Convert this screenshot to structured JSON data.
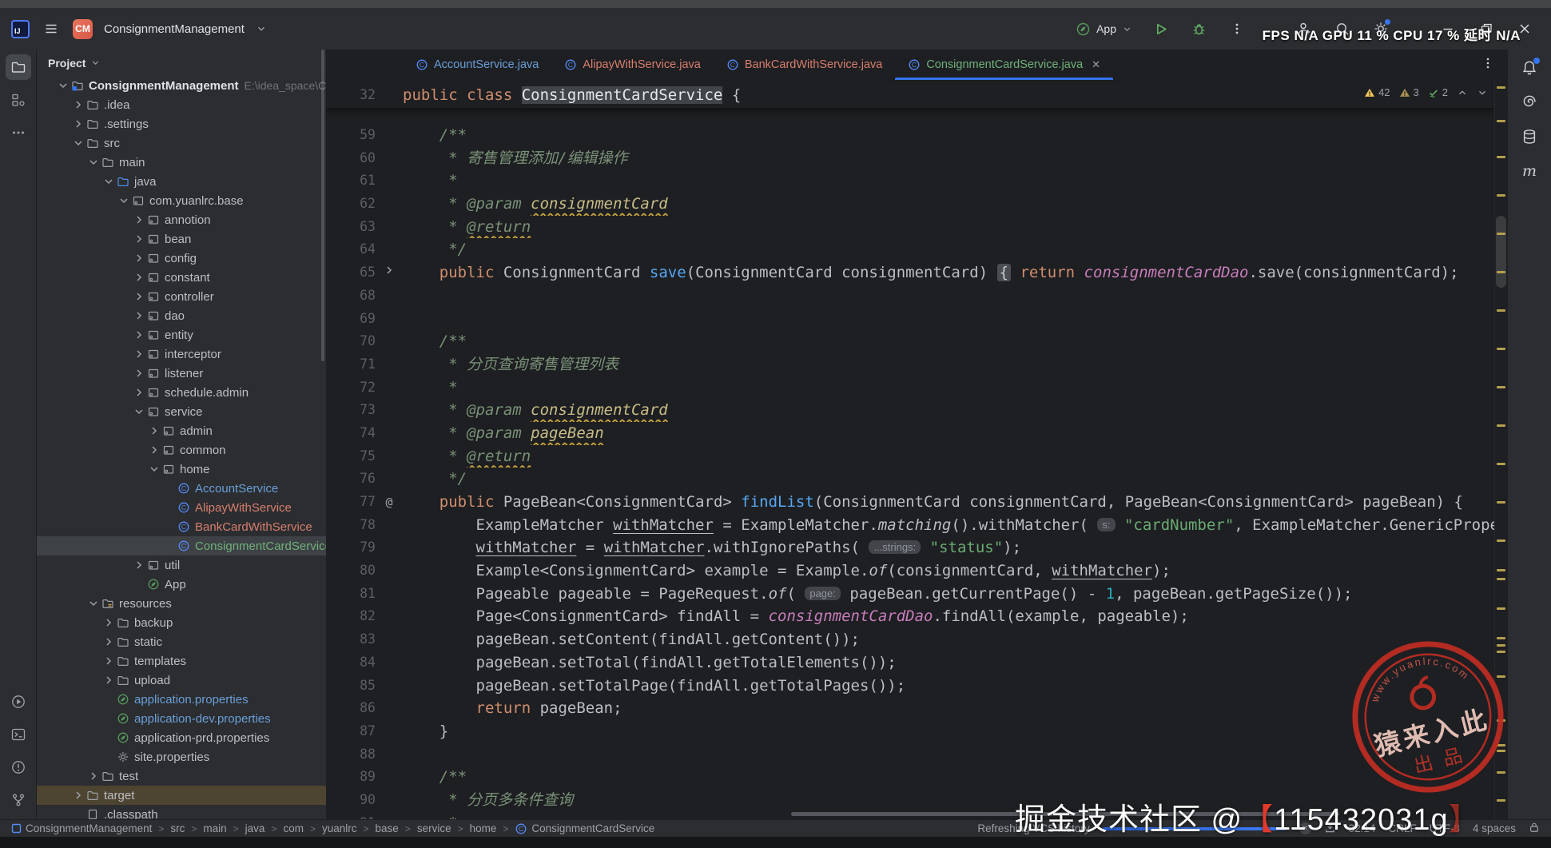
{
  "colors": {
    "accent": "#3574f0",
    "file_modified_blue": "#6a9fd8",
    "file_unversioned_red": "#d77e6d",
    "file_added_green": "#6fb17a",
    "warning_yellow": "#f2c55c",
    "weak_warning_yellow": "#a89052",
    "ok_green": "#5fad65",
    "spring_green": "#57965c",
    "stamp_red": "#bf2c22"
  },
  "title_bar": {
    "logo_badge": "CM",
    "project_name": "ConsignmentManagement",
    "run_config": "App",
    "overlay_stats": "FPS N/A GPU 11 % CPU 17 % 延时 N/A"
  },
  "project_panel": {
    "header": "Project",
    "tree": [
      {
        "label": "ConsignmentManagement",
        "level": 0,
        "chev": "v",
        "icon": "project",
        "bold": true,
        "path": "E:\\idea_space\\ConsignmentManagemen"
      },
      {
        "label": ".idea",
        "level": 1,
        "chev": ">",
        "icon": "folder"
      },
      {
        "label": ".settings",
        "level": 1,
        "chev": ">",
        "icon": "folder"
      },
      {
        "label": "src",
        "level": 1,
        "chev": "v",
        "icon": "folder"
      },
      {
        "label": "main",
        "level": 2,
        "chev": "v",
        "icon": "folder"
      },
      {
        "label": "java",
        "level": 3,
        "chev": "v",
        "icon": "folder-java"
      },
      {
        "label": "com.yuanlrc.base",
        "level": 4,
        "chev": "v",
        "icon": "package"
      },
      {
        "label": "annotion",
        "level": 5,
        "chev": ">",
        "icon": "package"
      },
      {
        "label": "bean",
        "level": 5,
        "chev": ">",
        "icon": "package"
      },
      {
        "label": "config",
        "level": 5,
        "chev": ">",
        "icon": "package"
      },
      {
        "label": "constant",
        "level": 5,
        "chev": ">",
        "icon": "package"
      },
      {
        "label": "controller",
        "level": 5,
        "chev": ">",
        "icon": "package"
      },
      {
        "label": "dao",
        "level": 5,
        "chev": ">",
        "icon": "package"
      },
      {
        "label": "entity",
        "level": 5,
        "chev": ">",
        "icon": "package"
      },
      {
        "label": "interceptor",
        "level": 5,
        "chev": ">",
        "icon": "package"
      },
      {
        "label": "listener",
        "level": 5,
        "chev": ">",
        "icon": "package"
      },
      {
        "label": "schedule.admin",
        "level": 5,
        "chev": ">",
        "icon": "package"
      },
      {
        "label": "service",
        "level": 5,
        "chev": "v",
        "icon": "package"
      },
      {
        "label": "admin",
        "level": 6,
        "chev": ">",
        "icon": "package"
      },
      {
        "label": "common",
        "level": 6,
        "chev": ">",
        "icon": "package"
      },
      {
        "label": "home",
        "level": 6,
        "chev": "v",
        "icon": "package"
      },
      {
        "label": "AccountService",
        "level": 7,
        "chev": null,
        "icon": "class",
        "color": "file_modified_blue"
      },
      {
        "label": "AlipayWithService",
        "level": 7,
        "chev": null,
        "icon": "class",
        "color": "file_unversioned_red"
      },
      {
        "label": "BankCardWithService",
        "level": 7,
        "chev": null,
        "icon": "class",
        "color": "file_unversioned_red"
      },
      {
        "label": "ConsignmentCardService",
        "level": 7,
        "chev": null,
        "icon": "class",
        "color": "file_added_green",
        "selected": true
      },
      {
        "label": "util",
        "level": 5,
        "chev": ">",
        "icon": "package"
      },
      {
        "label": "App",
        "level": 5,
        "chev": null,
        "icon": "spring"
      },
      {
        "label": "resources",
        "level": 2,
        "chev": "v",
        "icon": "folder-res"
      },
      {
        "label": "backup",
        "level": 3,
        "chev": ">",
        "icon": "folder"
      },
      {
        "label": "static",
        "level": 3,
        "chev": ">",
        "icon": "folder"
      },
      {
        "label": "templates",
        "level": 3,
        "chev": ">",
        "icon": "folder"
      },
      {
        "label": "upload",
        "level": 3,
        "chev": ">",
        "icon": "folder"
      },
      {
        "label": "application.properties",
        "level": 3,
        "chev": null,
        "icon": "spring",
        "color": "file_modified_blue"
      },
      {
        "label": "application-dev.properties",
        "level": 3,
        "chev": null,
        "icon": "spring",
        "color": "file_modified_blue"
      },
      {
        "label": "application-prd.properties",
        "level": 3,
        "chev": null,
        "icon": "spring"
      },
      {
        "label": "site.properties",
        "level": 3,
        "chev": null,
        "icon": "gear"
      },
      {
        "label": "test",
        "level": 2,
        "chev": ">",
        "icon": "folder"
      },
      {
        "label": "target",
        "level": 1,
        "chev": ">",
        "icon": "folder",
        "excluded": true
      },
      {
        "label": ".classpath",
        "level": 1,
        "chev": null,
        "icon": "file"
      }
    ]
  },
  "editor": {
    "tabs": [
      {
        "label": "AccountService.java",
        "color": "file_modified_blue",
        "active": false
      },
      {
        "label": "AlipayWithService.java",
        "color": "file_unversioned_red",
        "active": false
      },
      {
        "label": "BankCardWithService.java",
        "color": "file_unversioned_red",
        "active": false
      },
      {
        "label": "ConsignmentCardService.java",
        "color": "file_added_green",
        "active": true
      }
    ],
    "inspections": {
      "warnings": "42",
      "weak_warnings": "3",
      "ok": "2"
    },
    "sticky_line": {
      "n": "32",
      "s": [
        [
          "kw",
          "public class "
        ],
        [
          "hl",
          "ConsignmentCardService"
        ],
        [
          "def",
          " {"
        ]
      ]
    },
    "lines": [
      {
        "n": "59",
        "g": null,
        "s": [
          [
            "cmt",
            "    /**"
          ]
        ]
      },
      {
        "n": "60",
        "g": null,
        "s": [
          [
            "cmt",
            "     * 寄售管理添加/编辑操作"
          ]
        ]
      },
      {
        "n": "61",
        "g": null,
        "s": [
          [
            "cmt",
            "     *"
          ]
        ]
      },
      {
        "n": "62",
        "g": null,
        "s": [
          [
            "cmt",
            "     * @param "
          ],
          [
            "tagv",
            "consignmentCard"
          ]
        ]
      },
      {
        "n": "63",
        "g": null,
        "s": [
          [
            "cmt",
            "     * "
          ],
          [
            "cmtw",
            "@return"
          ]
        ]
      },
      {
        "n": "64",
        "g": null,
        "s": [
          [
            "cmt",
            "     */"
          ]
        ]
      },
      {
        "n": "65",
        "g": "fold",
        "s": [
          [
            "kw",
            "    public "
          ],
          [
            "def",
            "ConsignmentCard "
          ],
          [
            "mth",
            "save"
          ],
          [
            "def",
            "(ConsignmentCard consignmentCard) "
          ],
          [
            "fold",
            "{"
          ],
          [
            "def",
            " "
          ],
          [
            "kw",
            "return "
          ],
          [
            "fld",
            "consignmentCardDao"
          ],
          [
            "def",
            ".save(consignmentCard);"
          ]
        ]
      },
      {
        "n": "68",
        "g": null,
        "s": []
      },
      {
        "n": "69",
        "g": null,
        "s": []
      },
      {
        "n": "70",
        "g": null,
        "s": [
          [
            "cmt",
            "    /**"
          ]
        ]
      },
      {
        "n": "71",
        "g": null,
        "s": [
          [
            "cmt",
            "     * 分页查询寄售管理列表"
          ]
        ]
      },
      {
        "n": "72",
        "g": null,
        "s": [
          [
            "cmt",
            "     *"
          ]
        ]
      },
      {
        "n": "73",
        "g": null,
        "s": [
          [
            "cmt",
            "     * @param "
          ],
          [
            "tagv",
            "consignmentCard"
          ]
        ]
      },
      {
        "n": "74",
        "g": null,
        "s": [
          [
            "cmt",
            "     * @param "
          ],
          [
            "tagv",
            "pageBean"
          ]
        ]
      },
      {
        "n": "75",
        "g": null,
        "s": [
          [
            "cmt",
            "     * "
          ],
          [
            "cmtw",
            "@return"
          ]
        ]
      },
      {
        "n": "76",
        "g": null,
        "s": [
          [
            "cmt",
            "     */"
          ]
        ]
      },
      {
        "n": "77",
        "g": "at",
        "s": [
          [
            "kw",
            "    public "
          ],
          [
            "def",
            "PageBean<ConsignmentCard> "
          ],
          [
            "mth",
            "findList"
          ],
          [
            "def",
            "(ConsignmentCard consignmentCard, PageBean<ConsignmentCard> pageBean) {"
          ]
        ]
      },
      {
        "n": "78",
        "g": null,
        "s": [
          [
            "def",
            "        ExampleMatcher "
          ],
          [
            "undl",
            "withMatcher"
          ],
          [
            "def",
            " = ExampleMatcher."
          ],
          [
            "ital",
            "matching"
          ],
          [
            "def",
            "().withMatcher( "
          ],
          [
            "hint",
            "s:"
          ],
          [
            "def",
            " "
          ],
          [
            "str",
            "\"cardNumber\""
          ],
          [
            "def",
            ", ExampleMatcher.GenericPropertyMatchers"
          ]
        ]
      },
      {
        "n": "79",
        "g": null,
        "s": [
          [
            "def",
            "        "
          ],
          [
            "undl",
            "withMatcher"
          ],
          [
            "def",
            " = "
          ],
          [
            "undl",
            "withMatcher"
          ],
          [
            "def",
            ".withIgnorePaths( "
          ],
          [
            "hint",
            "...strings:"
          ],
          [
            "def",
            " "
          ],
          [
            "str",
            "\"status\""
          ],
          [
            "def",
            ");"
          ]
        ]
      },
      {
        "n": "80",
        "g": null,
        "s": [
          [
            "def",
            "        Example<ConsignmentCard> example = Example."
          ],
          [
            "ital",
            "of"
          ],
          [
            "def",
            "(consignmentCard, "
          ],
          [
            "undl",
            "withMatcher"
          ],
          [
            "def",
            ");"
          ]
        ]
      },
      {
        "n": "81",
        "g": null,
        "s": [
          [
            "def",
            "        Pageable pageable = PageRequest."
          ],
          [
            "ital",
            "of"
          ],
          [
            "def",
            "( "
          ],
          [
            "hint",
            "page:"
          ],
          [
            "def",
            " pageBean.getCurrentPage() - "
          ],
          [
            "num",
            "1"
          ],
          [
            "def",
            ", pageBean.getPageSize());"
          ]
        ]
      },
      {
        "n": "82",
        "g": null,
        "s": [
          [
            "def",
            "        Page<ConsignmentCard> findAll = "
          ],
          [
            "fld",
            "consignmentCardDao"
          ],
          [
            "def",
            ".findAll(example, pageable);"
          ]
        ]
      },
      {
        "n": "83",
        "g": null,
        "s": [
          [
            "def",
            "        pageBean.setContent(findAll.getContent());"
          ]
        ]
      },
      {
        "n": "84",
        "g": null,
        "s": [
          [
            "def",
            "        pageBean.setTotal(findAll.getTotalElements());"
          ]
        ]
      },
      {
        "n": "85",
        "g": null,
        "s": [
          [
            "def",
            "        pageBean.setTotalPage(findAll.getTotalPages());"
          ]
        ]
      },
      {
        "n": "86",
        "g": null,
        "s": [
          [
            "def",
            "        "
          ],
          [
            "kw",
            "return"
          ],
          [
            "def",
            " pageBean;"
          ]
        ]
      },
      {
        "n": "87",
        "g": null,
        "s": [
          [
            "def",
            "    }"
          ]
        ]
      },
      {
        "n": "88",
        "g": null,
        "s": []
      },
      {
        "n": "89",
        "g": null,
        "s": [
          [
            "cmt",
            "    /**"
          ]
        ]
      },
      {
        "n": "90",
        "g": null,
        "s": [
          [
            "cmt",
            "     * 分页多条件查询"
          ]
        ]
      },
      {
        "n": "91",
        "g": null,
        "s": [
          [
            "cmt",
            "     *"
          ]
        ]
      }
    ],
    "stripe_marks": [
      46,
      88,
      133,
      181,
      229,
      277,
      325,
      373,
      421,
      469,
      517,
      565,
      613,
      650,
      661,
      698,
      735,
      744,
      752,
      783,
      838,
      869,
      876,
      903,
      938
    ]
  },
  "status_bar": {
    "breadcrumbs": [
      "ConsignmentManagement",
      "src",
      "main",
      "java",
      "com",
      "yuanlrc",
      "base",
      "service",
      "home",
      "ConsignmentCardService"
    ],
    "vcs_status": "Refreshing VCS history",
    "caret": "32:14",
    "line_ending": "CRLF",
    "encoding": "UTF-8",
    "indent": "4 spaces"
  },
  "watermark": {
    "community": "掘金技术社区 @",
    "bracket_open": "【",
    "uid": "115432031g",
    "bracket_close": "】",
    "stamp": {
      "arc_text": "www.yuanlrc.com",
      "main_text": "猿来入此",
      "sub_text": "出品"
    }
  }
}
